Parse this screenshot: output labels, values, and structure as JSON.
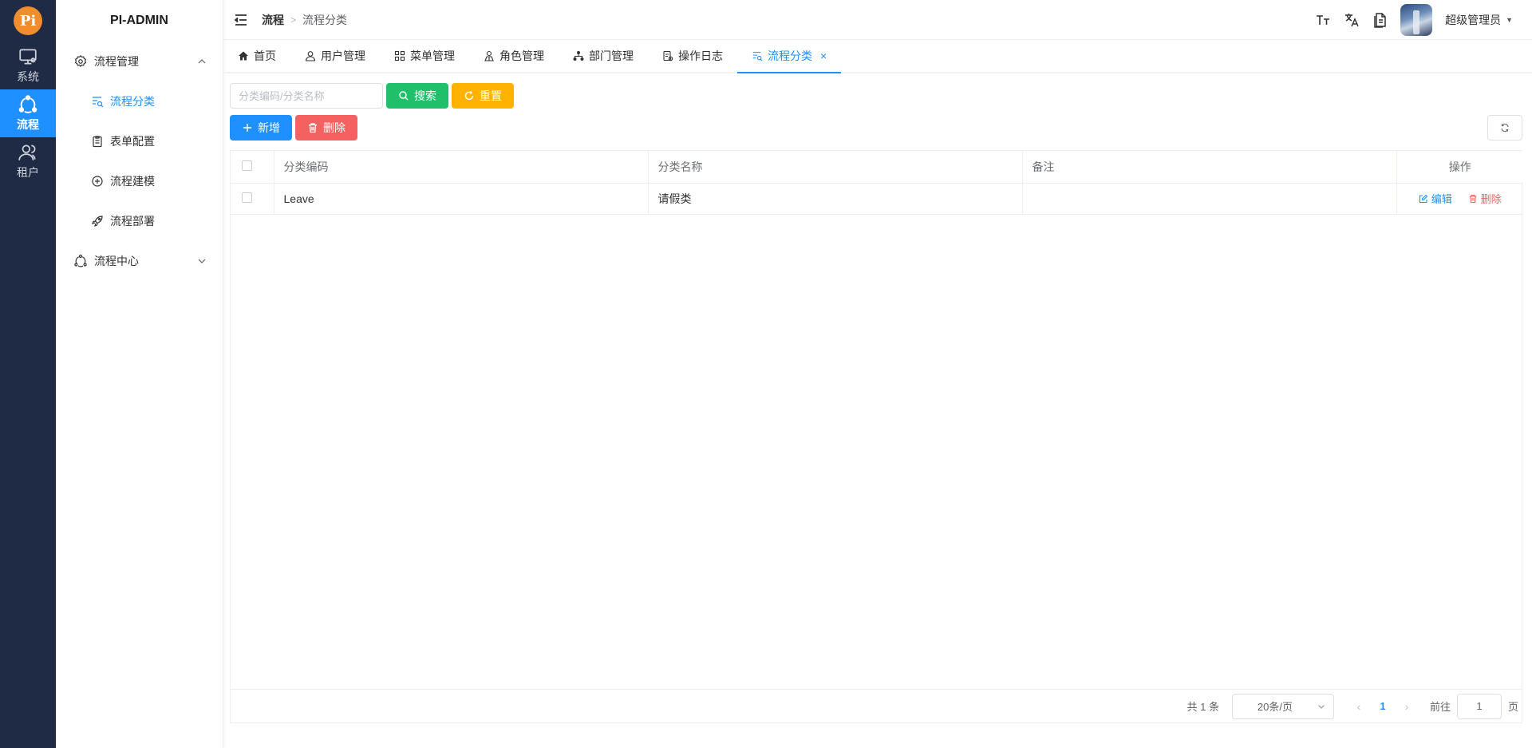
{
  "rail": {
    "logo": "Pi",
    "items": [
      {
        "label": "系统",
        "icon": "monitor-icon",
        "active": false
      },
      {
        "label": "流程",
        "icon": "flow-cycle-icon",
        "active": true
      },
      {
        "label": "租户",
        "icon": "users-icon",
        "active": false
      }
    ]
  },
  "sidebar": {
    "brand": "PI-ADMIN",
    "group1": {
      "label": "流程管理",
      "icon": "settings-circle-icon",
      "expanded": true
    },
    "items": [
      {
        "label": "流程分类",
        "icon": "list-search-icon",
        "active": true
      },
      {
        "label": "表单配置",
        "icon": "clipboard-icon",
        "active": false
      },
      {
        "label": "流程建模",
        "icon": "plus-circle-icon",
        "active": false
      },
      {
        "label": "流程部署",
        "icon": "rocket-icon",
        "active": false
      }
    ],
    "group2": {
      "label": "流程中心",
      "icon": "flow-cycle-icon",
      "expanded": false
    }
  },
  "header": {
    "breadcrumb": [
      "流程",
      "流程分类"
    ],
    "username": "超级管理员"
  },
  "tabs": [
    {
      "label": "首页",
      "icon": "home-icon",
      "active": false
    },
    {
      "label": "用户管理",
      "icon": "user-icon",
      "active": false
    },
    {
      "label": "菜单管理",
      "icon": "grid-icon",
      "active": false
    },
    {
      "label": "角色管理",
      "icon": "role-icon",
      "active": false
    },
    {
      "label": "部门管理",
      "icon": "org-icon",
      "active": false
    },
    {
      "label": "操作日志",
      "icon": "log-icon",
      "active": false
    },
    {
      "label": "流程分类",
      "icon": "list-search-icon",
      "active": true,
      "closable": true
    }
  ],
  "search": {
    "placeholder": "分类编码/分类名称",
    "value": "",
    "search_label": "搜索",
    "reset_label": "重置"
  },
  "actions": {
    "add_label": "新增",
    "delete_label": "删除"
  },
  "table": {
    "columns": [
      "分类编码",
      "分类名称",
      "备注",
      "操作"
    ],
    "rows": [
      {
        "code": "Leave",
        "name": "请假类",
        "remark": "",
        "edit_label": "编辑",
        "delete_label": "删除"
      }
    ]
  },
  "pager": {
    "total_text": "共 1 条",
    "page_size": "20条/页",
    "current_page": "1",
    "goto_label": "前往",
    "goto_value": "1",
    "page_suffix": "页"
  },
  "colors": {
    "primary": "#1e90ff",
    "success": "#1fc069",
    "warning": "#ffb300",
    "danger": "#f56060",
    "rail_bg": "#1f2a44",
    "logo": "#f08d2c"
  }
}
